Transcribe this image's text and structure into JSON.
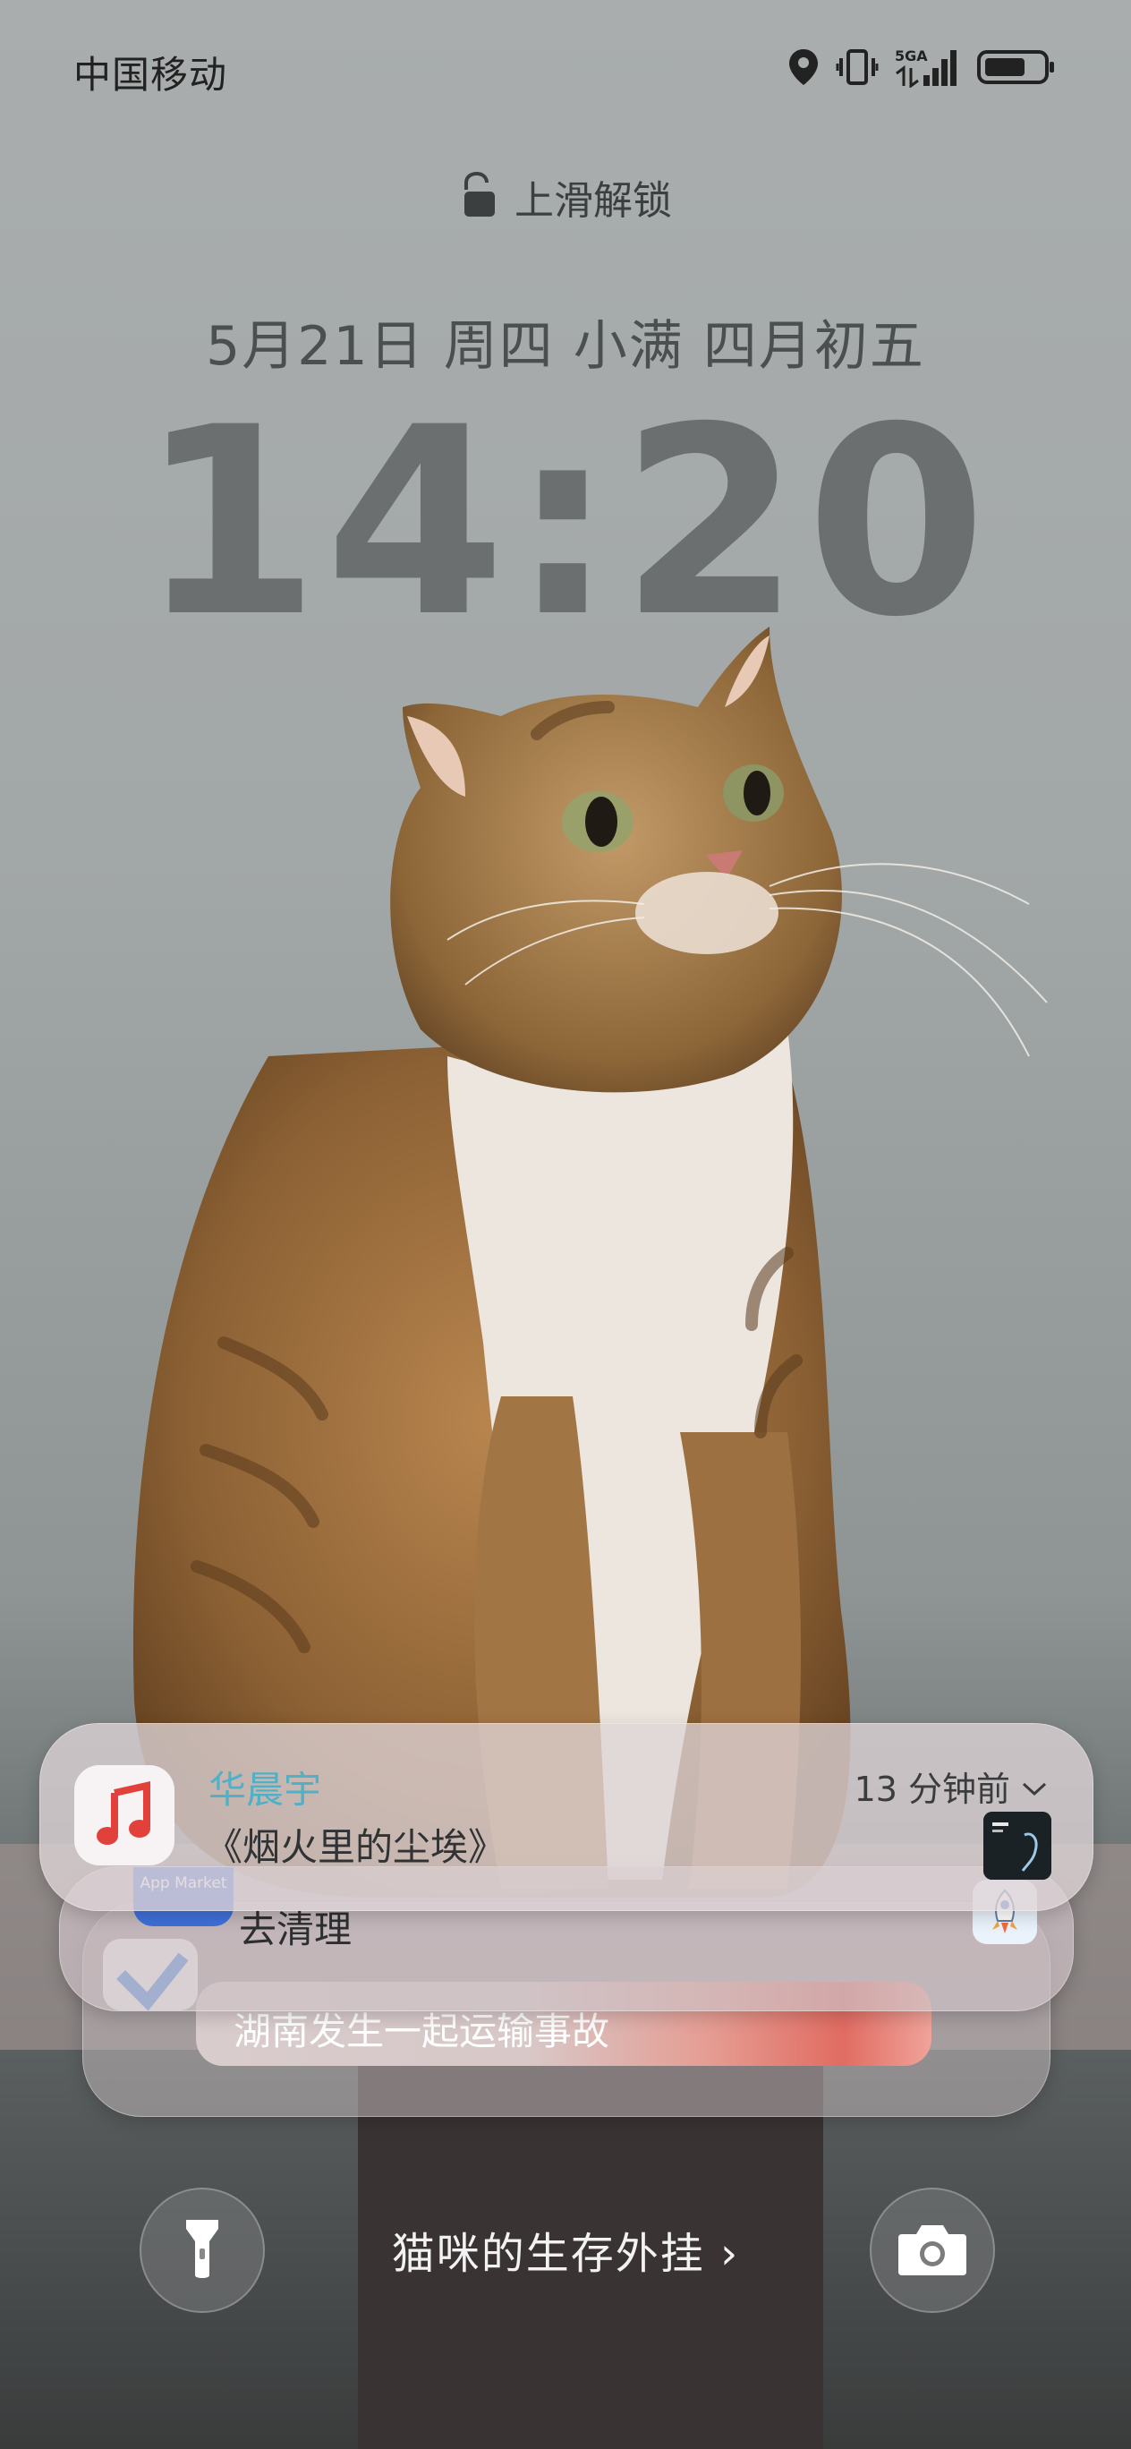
{
  "status_bar": {
    "carrier": "中国移动",
    "network": "5GA",
    "icons": [
      "location-icon",
      "vibrate-icon",
      "signal-5ga-icon",
      "battery-icon"
    ]
  },
  "lock": {
    "unlock_hint": "上滑解锁",
    "date": "5月21日 周四 小满 四月初五",
    "time": "14:20"
  },
  "notifications": [
    {
      "app": "华晨宇",
      "body": "《烟火里的尘埃》",
      "time": "13 分钟前",
      "icon": "music-icon"
    },
    {
      "app_label": "App Market",
      "body": "去清理",
      "icon": "rocket-icon"
    },
    {
      "body": "湖南发生一起运输事故"
    }
  ],
  "bottom": {
    "promo": "猫咪的生存外挂 ›",
    "left_button_icon": "flashlight-icon",
    "right_button_icon": "camera-icon"
  }
}
